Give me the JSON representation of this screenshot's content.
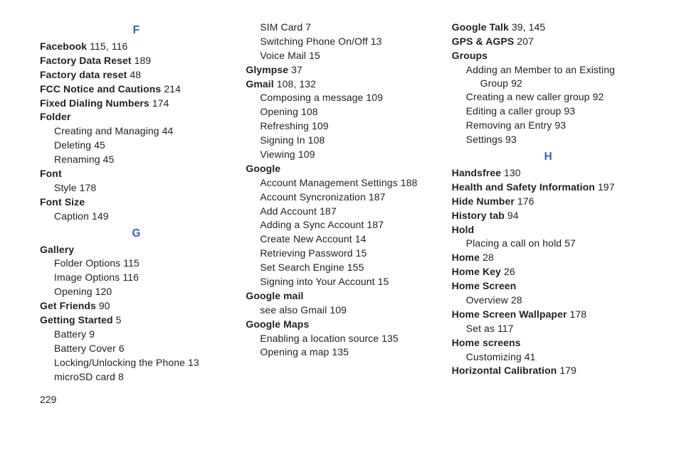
{
  "page_number": "229",
  "columns": [
    [
      {
        "type": "letter",
        "text": "F"
      },
      {
        "type": "topic",
        "topic": "Facebook",
        "pages": "115, 116"
      },
      {
        "type": "topic",
        "topic": "Factory Data Reset",
        "pages": "189"
      },
      {
        "type": "topic",
        "topic": "Factory data reset",
        "pages": "48"
      },
      {
        "type": "topic",
        "topic": "FCC Notice and Cautions",
        "pages": "214"
      },
      {
        "type": "topic",
        "topic": "Fixed Dialing Numbers",
        "pages": "174"
      },
      {
        "type": "topic",
        "topic": "Folder"
      },
      {
        "type": "sub",
        "text": "Creating and Managing",
        "pages": "44"
      },
      {
        "type": "sub",
        "text": "Deleting",
        "pages": "45"
      },
      {
        "type": "sub",
        "text": "Renaming",
        "pages": "45"
      },
      {
        "type": "topic",
        "topic": "Font"
      },
      {
        "type": "sub",
        "text": "Style",
        "pages": "178"
      },
      {
        "type": "topic",
        "topic": "Font Size"
      },
      {
        "type": "sub",
        "text": "Caption",
        "pages": "149"
      },
      {
        "type": "letter",
        "text": "G"
      },
      {
        "type": "topic",
        "topic": "Gallery"
      },
      {
        "type": "sub",
        "text": "Folder Options",
        "pages": "115"
      },
      {
        "type": "sub",
        "text": "Image Options",
        "pages": "116"
      },
      {
        "type": "sub",
        "text": "Opening",
        "pages": "120"
      },
      {
        "type": "topic",
        "topic": "Get Friends",
        "pages": "90"
      },
      {
        "type": "topic",
        "topic": "Getting Started",
        "pages": "5"
      },
      {
        "type": "sub",
        "text": "Battery",
        "pages": "9"
      },
      {
        "type": "sub",
        "text": "Battery Cover",
        "pages": "6"
      },
      {
        "type": "sub",
        "text": "Locking/Unlocking the Phone",
        "pages": "13"
      },
      {
        "type": "sub",
        "text": "microSD card",
        "pages": "8"
      }
    ],
    [
      {
        "type": "sub",
        "text": "SIM Card",
        "pages": "7"
      },
      {
        "type": "sub",
        "text": "Switching Phone On/Off",
        "pages": "13"
      },
      {
        "type": "sub",
        "text": "Voice Mail",
        "pages": "15"
      },
      {
        "type": "topic",
        "topic": "Glympse",
        "pages": "37"
      },
      {
        "type": "topic",
        "topic": "Gmail",
        "pages": "108, 132"
      },
      {
        "type": "sub",
        "text": "Composing a message",
        "pages": "109"
      },
      {
        "type": "sub",
        "text": "Opening",
        "pages": "108"
      },
      {
        "type": "sub",
        "text": "Refreshing",
        "pages": "109"
      },
      {
        "type": "sub",
        "text": "Signing In",
        "pages": "108"
      },
      {
        "type": "sub",
        "text": "Viewing",
        "pages": "109"
      },
      {
        "type": "topic",
        "topic": "Google"
      },
      {
        "type": "sub",
        "text": "Account Management Settings",
        "pages": "188"
      },
      {
        "type": "sub",
        "text": "Account Syncronization",
        "pages": "187"
      },
      {
        "type": "sub",
        "text": "Add Account",
        "pages": "187"
      },
      {
        "type": "sub",
        "text": "Adding a Sync Account",
        "pages": "187"
      },
      {
        "type": "sub",
        "text": "Create New Account",
        "pages": "14"
      },
      {
        "type": "sub",
        "text": "Retrieving Password",
        "pages": "15"
      },
      {
        "type": "sub",
        "text": "Set Search Engine",
        "pages": "155"
      },
      {
        "type": "sub",
        "text": "Signing into Your Account",
        "pages": "15"
      },
      {
        "type": "topic",
        "topic": "Google mail"
      },
      {
        "type": "sub",
        "text": "see also Gmail",
        "pages": "109"
      },
      {
        "type": "topic",
        "topic": "Google Maps"
      },
      {
        "type": "sub",
        "text": "Enabling a location source",
        "pages": "135"
      },
      {
        "type": "sub",
        "text": "Opening a map",
        "pages": "135"
      }
    ],
    [
      {
        "type": "topic",
        "topic": "Google Talk",
        "pages": "39, 145"
      },
      {
        "type": "topic",
        "topic": "GPS & AGPS",
        "pages": "207"
      },
      {
        "type": "topic",
        "topic": "Groups"
      },
      {
        "type": "sub",
        "wrap": true,
        "text": "Adding an Member to an Existing Group",
        "pages": "92"
      },
      {
        "type": "sub",
        "text": "Creating a new caller group",
        "pages": "92"
      },
      {
        "type": "sub",
        "text": "Editing a caller group",
        "pages": "93"
      },
      {
        "type": "sub",
        "text": "Removing an Entry",
        "pages": "93"
      },
      {
        "type": "sub",
        "text": "Settings",
        "pages": "93"
      },
      {
        "type": "letter",
        "text": "H"
      },
      {
        "type": "topic",
        "topic": "Handsfree",
        "pages": "130"
      },
      {
        "type": "topic",
        "topic": "Health and Safety Information",
        "pages": "197"
      },
      {
        "type": "topic",
        "topic": "Hide Number",
        "pages": "176"
      },
      {
        "type": "topic",
        "topic": "History tab",
        "pages": "94"
      },
      {
        "type": "topic",
        "topic": "Hold"
      },
      {
        "type": "sub",
        "text": "Placing a call on hold",
        "pages": "57"
      },
      {
        "type": "topic",
        "topic": "Home",
        "pages": "28"
      },
      {
        "type": "topic",
        "topic": "Home Key",
        "pages": "26"
      },
      {
        "type": "topic",
        "topic": "Home Screen"
      },
      {
        "type": "sub",
        "text": "Overview",
        "pages": "28"
      },
      {
        "type": "topic",
        "topic": "Home Screen Wallpaper",
        "pages": "178"
      },
      {
        "type": "sub",
        "text": "Set as",
        "pages": "117"
      },
      {
        "type": "topic",
        "topic": "Home screens"
      },
      {
        "type": "sub",
        "text": "Customizing",
        "pages": "41"
      },
      {
        "type": "topic",
        "topic": "Horizontal Calibration",
        "pages": "179"
      }
    ]
  ]
}
